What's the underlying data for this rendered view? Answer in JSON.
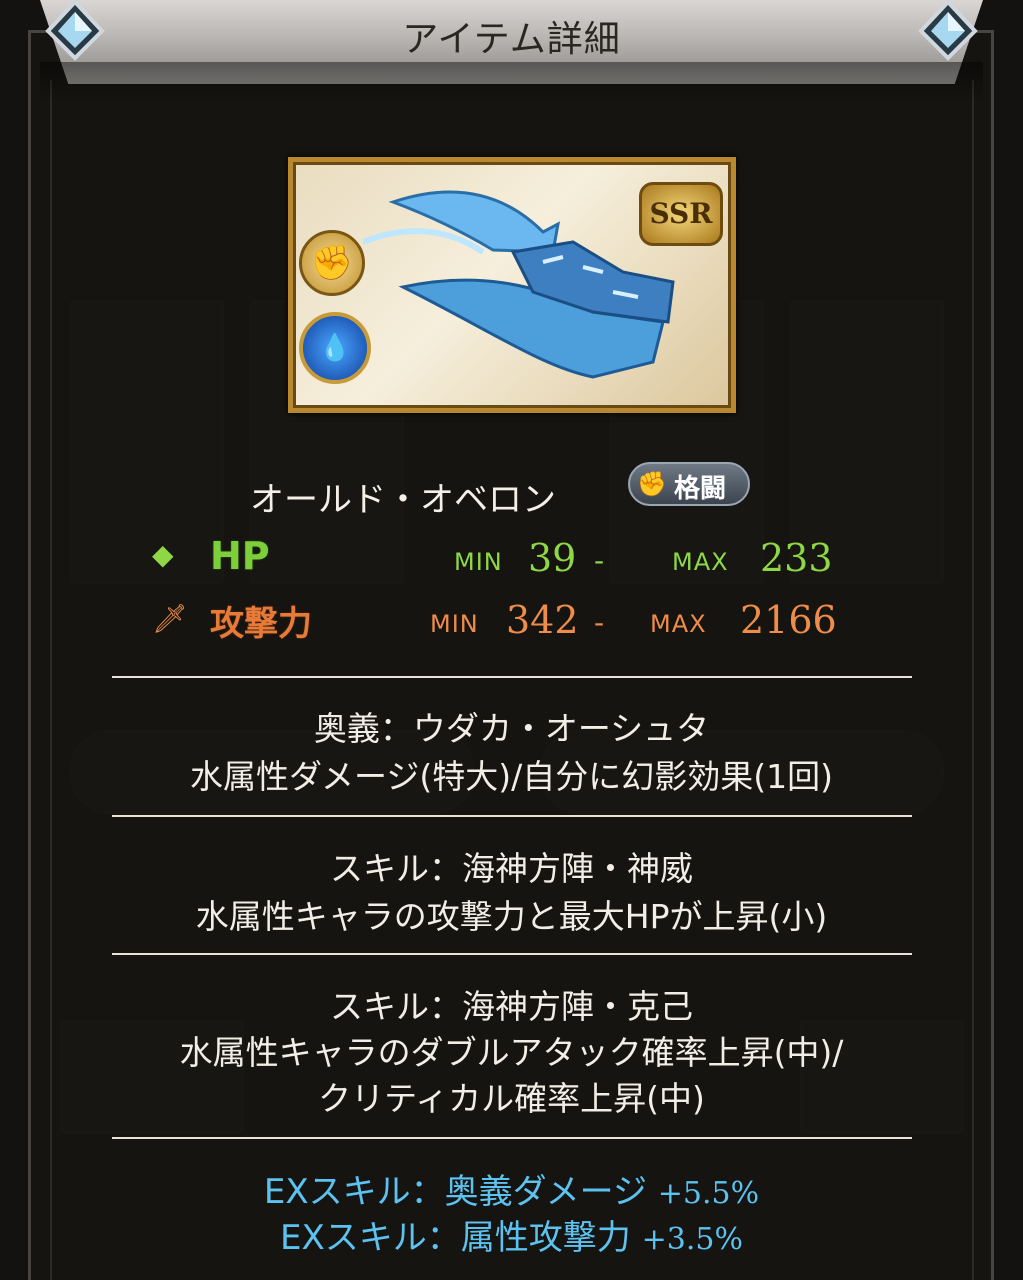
{
  "header": {
    "title": "アイテム詳細"
  },
  "item": {
    "name": "オールド・オベロン",
    "rarity": "SSR",
    "weapon_type": "格闘",
    "weapon_type_icon": "fist-icon",
    "element_icon": "water-element-icon"
  },
  "stats": {
    "hp": {
      "label": "HP",
      "min_label": "MIN",
      "min": "39",
      "dash": "-",
      "max_label": "MAX",
      "max": "233",
      "color": "#8ed845"
    },
    "atk": {
      "label": "攻撃力",
      "min_label": "MIN",
      "min": "342",
      "dash": "-",
      "max_label": "MAX",
      "max": "2166",
      "color": "#ee8c4a"
    }
  },
  "ougi": {
    "name": "奥義：ウダカ・オーシュタ",
    "effect": "水属性ダメージ(特大)/自分に幻影効果(1回)"
  },
  "skills": [
    {
      "name": "スキル：海神方陣・神威",
      "lines": [
        "水属性キャラの攻撃力と最大HPが上昇(小)"
      ]
    },
    {
      "name": "スキル：海神方陣・克己",
      "lines": [
        "水属性キャラのダブルアタック確率上昇(中)/",
        "クリティカル確率上昇(中)"
      ]
    }
  ],
  "ex_skills": [
    {
      "label": "EXスキル：奥義ダメージ",
      "bonus": "+5.5%"
    },
    {
      "label": "EXスキル：属性攻撃力",
      "bonus": "+3.5%"
    }
  ]
}
